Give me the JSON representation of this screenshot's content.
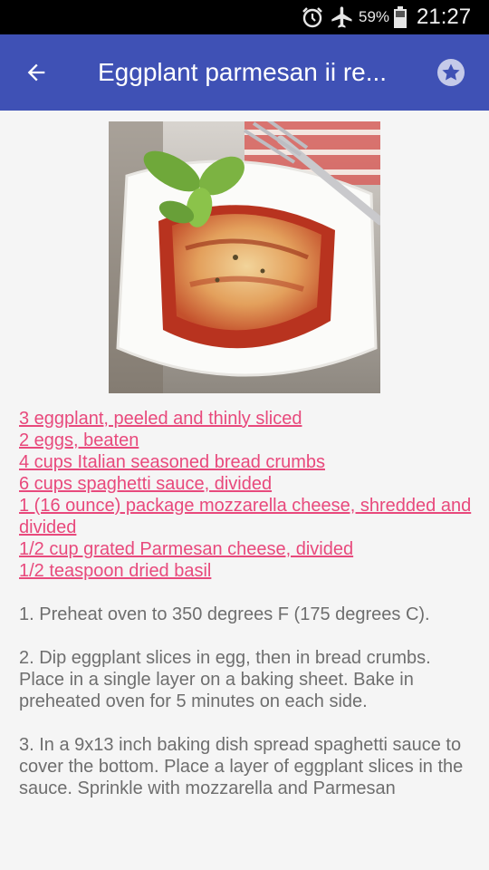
{
  "status_bar": {
    "battery_percent": "59%",
    "time": "21:27",
    "icons": [
      "alarm-icon",
      "airplane-mode-icon",
      "battery-icon"
    ]
  },
  "app_bar": {
    "title": "Eggplant parmesan ii re...",
    "color": "#3f51b5",
    "back_icon": "arrow-back-icon",
    "favorite_icon": "star-icon"
  },
  "recipe": {
    "image": "photo of eggplant parmesan on a white plate with basil and fork",
    "ingredients": [
      "3 eggplant, peeled and thinly sliced",
      "2 eggs, beaten",
      "4 cups Italian seasoned bread crumbs",
      "6 cups spaghetti sauce, divided",
      "1 (16 ounce) package mozzarella cheese, shredded and divided",
      "1/2 cup grated Parmesan cheese, divided",
      "1/2 teaspoon dried basil"
    ],
    "link_color": "#e8497c",
    "steps": [
      "1. Preheat oven to 350 degrees F (175 degrees C).",
      "2. Dip eggplant slices in egg, then in bread crumbs. Place in a single layer on a baking sheet. Bake in preheated oven for 5 minutes on each side.",
      "3. In a 9x13 inch baking dish spread spaghetti sauce to cover the bottom. Place a layer of eggplant slices in the sauce. Sprinkle with mozzarella and Parmesan"
    ]
  }
}
